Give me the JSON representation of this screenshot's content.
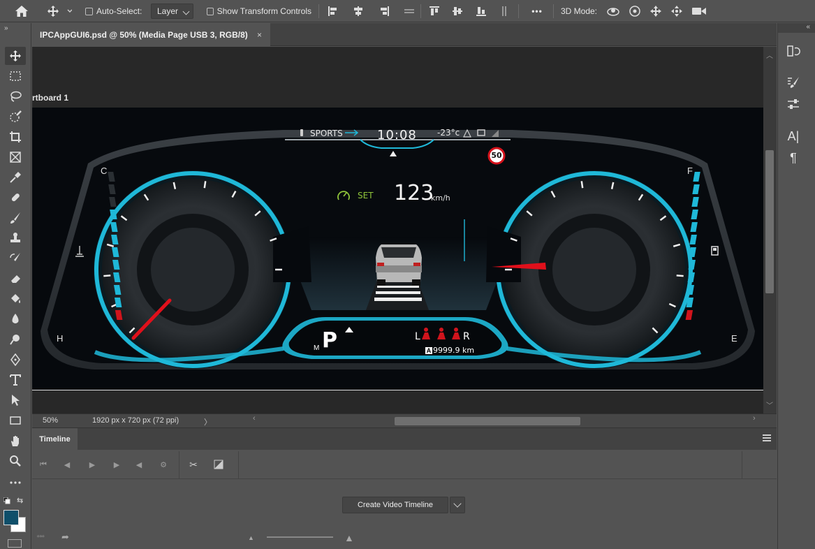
{
  "options_bar": {
    "auto_select_label": "Auto-Select:",
    "auto_select_value": "Layer",
    "show_transform_label": "Show Transform Controls",
    "mode_3d_label": "3D Mode:",
    "more_label": "•••"
  },
  "document": {
    "tab_title": "IPCAppGUI6.psd @ 50% (Media Page USB 3, RGB/8)",
    "close_glyph": "×",
    "artboard_label": "rtboard 1"
  },
  "status": {
    "zoom": "50%",
    "doc_size": "1920 px x 720 px (72 ppi)"
  },
  "timeline": {
    "tab_label": "Timeline",
    "create_button_label": "Create Video Timeline"
  },
  "cluster": {
    "drive_mode": "SPORTS",
    "clock": "10:08",
    "temperature": "-23°c",
    "speed_limit": "50",
    "cruise_label": "SET",
    "speed": "123",
    "speed_unit": "km/h",
    "gear": "P",
    "gear_mode": "M",
    "left_gauge_top": "C",
    "left_gauge_bottom": "H",
    "right_gauge_top": "F",
    "right_gauge_bottom": "E",
    "belt_left": "L",
    "belt_right": "R",
    "odometer_badge": "A",
    "odometer": "9999.9 km",
    "colors": {
      "accent": "#1fb8d8",
      "needle": "#e0101b",
      "cruise": "#8fc43a"
    }
  }
}
